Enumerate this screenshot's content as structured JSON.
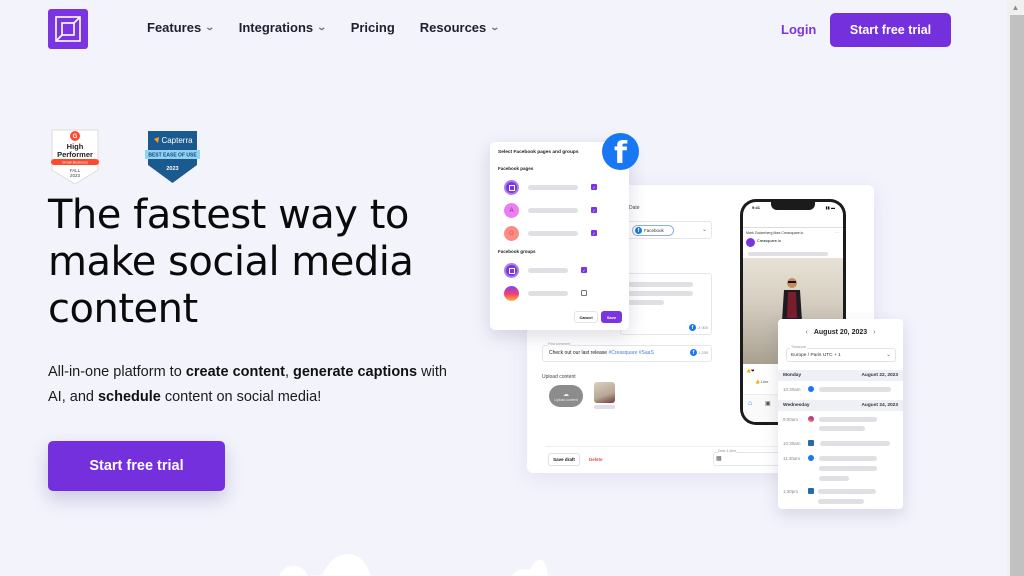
{
  "nav": {
    "logo": "logo-icon",
    "items": [
      {
        "label": "Features",
        "has_dropdown": true
      },
      {
        "label": "Integrations",
        "has_dropdown": true
      },
      {
        "label": "Pricing",
        "has_dropdown": false
      },
      {
        "label": "Resources",
        "has_dropdown": true
      }
    ],
    "chevron": "⌄",
    "login": "Login",
    "cta": "Start free trial"
  },
  "badges": {
    "g2": {
      "line1": "High",
      "line2": "Performer",
      "ribbon": "Small Business",
      "season": "FALL",
      "year": "2023"
    },
    "capterra": {
      "brand": "Capterra",
      "ribbon": "BEST EASE OF USE",
      "year": "2023"
    }
  },
  "hero": {
    "headline": "The fastest way to make social media content",
    "sub_parts": [
      "All-in-one platform to ",
      "create content",
      ", ",
      "generate captions",
      " with AI, and ",
      "schedule",
      " content on social media!"
    ],
    "cta": "Start free trial"
  },
  "mockup": {
    "modal": {
      "title": "Select Facebook pages and groups",
      "pages_label": "Facebook pages",
      "groups_label": "Facebook groups",
      "pages": [
        {
          "avatar": "",
          "checked": true
        },
        {
          "avatar": "A",
          "checked": true
        },
        {
          "avatar": "G",
          "checked": true
        }
      ],
      "groups": [
        {
          "avatar": "",
          "checked": true
        },
        {
          "avatar": "",
          "checked": false
        }
      ],
      "cancel": "Cancel",
      "save": "Save"
    },
    "editor": {
      "date_label": "Date",
      "chip": "Facebook",
      "char_count": "2 000",
      "first_comment_label": "First comment",
      "first_comment": "Check out our last release ",
      "first_comment_tags": "#Creasquare #SaaS",
      "comment_count": "1 230",
      "upload_label": "Upload content",
      "upload_button": "Upload content",
      "save_draft": "Save draft",
      "delete": "Delete",
      "date_time_label": "Date & time"
    },
    "phone": {
      "time": "9:41",
      "post_header": "Mark Zuckerberg likes Creasquare.io",
      "page_name": "Creasquare.io",
      "like": "Like"
    },
    "calendar": {
      "title": "August 20, 2023",
      "prev": "‹",
      "next": "›",
      "timezone_label": "Timezone",
      "timezone": "Europe / Paris UTC + 1",
      "days": [
        {
          "day": "Monday",
          "date": "August 22, 2023",
          "slots": [
            {
              "time": "10:30am",
              "network": "facebook"
            }
          ]
        },
        {
          "day": "Wednesday",
          "date": "August 24, 2023",
          "slots": [
            {
              "time": "9:00am",
              "network": "instagram"
            },
            {
              "time": "10:30am",
              "network": "linkedin"
            },
            {
              "time": "11:30am",
              "network": "facebook"
            },
            {
              "time": "1:30pm",
              "network": "linkedin"
            }
          ]
        }
      ]
    }
  },
  "colors": {
    "brand": "#7430dd",
    "background": "#f3f3fc",
    "facebook": "#1877f2"
  }
}
